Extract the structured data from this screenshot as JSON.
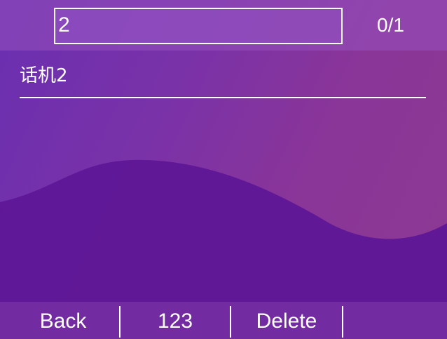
{
  "search": {
    "value": "2",
    "counter": "0/1"
  },
  "contact": {
    "name": "话机2"
  },
  "softkeys": {
    "back": "Back",
    "mode": "123",
    "delete": "Delete",
    "empty": ""
  }
}
